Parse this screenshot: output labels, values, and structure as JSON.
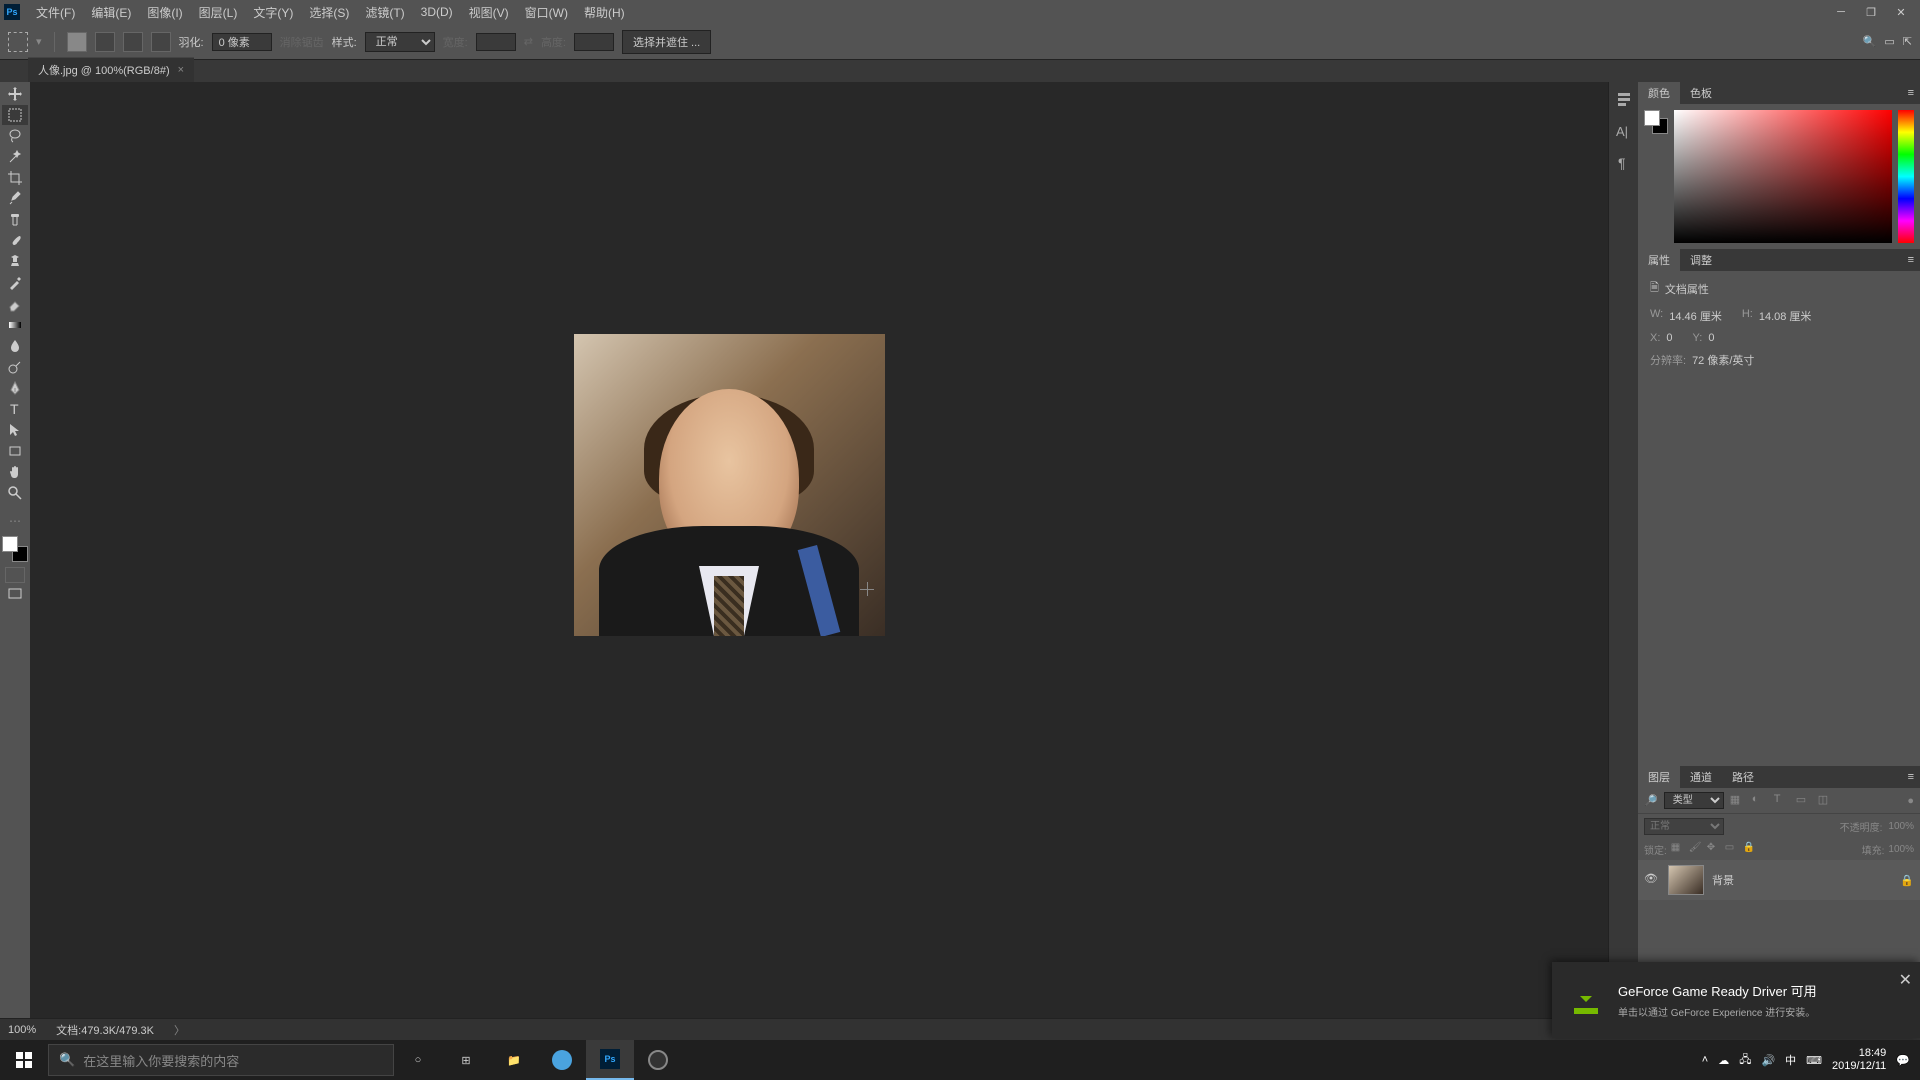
{
  "menubar": {
    "items": [
      "文件(F)",
      "编辑(E)",
      "图像(I)",
      "图层(L)",
      "文字(Y)",
      "选择(S)",
      "滤镜(T)",
      "3D(D)",
      "视图(V)",
      "窗口(W)",
      "帮助(H)"
    ]
  },
  "optbar": {
    "feather_label": "羽化:",
    "feather_value": "0 像素",
    "antialias": "消除锯齿",
    "style_label": "样式:",
    "style_value": "正常",
    "width_label": "宽度:",
    "height_label": "高度:",
    "select_mask": "选择并遮住 ..."
  },
  "tab": {
    "title": "人像.jpg @ 100%(RGB/8#)"
  },
  "panels": {
    "color_tabs": [
      "颜色",
      "色板"
    ],
    "props_tabs": [
      "属性",
      "调整"
    ],
    "props_title": "文档属性",
    "props": {
      "w_label": "W:",
      "w_value": "14.46 厘米",
      "h_label": "H:",
      "h_value": "14.08 厘米",
      "x_label": "X:",
      "x_value": "0",
      "y_label": "Y:",
      "y_value": "0",
      "res_label": "分辨率:",
      "res_value": "72 像素/英寸"
    },
    "layers_tabs": [
      "图层",
      "通道",
      "路径"
    ],
    "layers": {
      "type_label": "类型",
      "blend_mode": "正常",
      "opacity_label": "不透明度:",
      "opacity_value": "100%",
      "lock_label": "锁定:",
      "fill_label": "填充:",
      "fill_value": "100%",
      "layer_name": "背景"
    }
  },
  "statusbar": {
    "zoom": "100%",
    "doc": "文档:479.3K/479.3K"
  },
  "notif": {
    "title": "GeForce Game Ready Driver 可用",
    "sub": "单击以通过 GeForce Experience 进行安装。"
  },
  "taskbar": {
    "search_placeholder": "在这里输入你要搜索的内容",
    "ime": "中",
    "time": "18:49",
    "date": "2019/12/11"
  }
}
